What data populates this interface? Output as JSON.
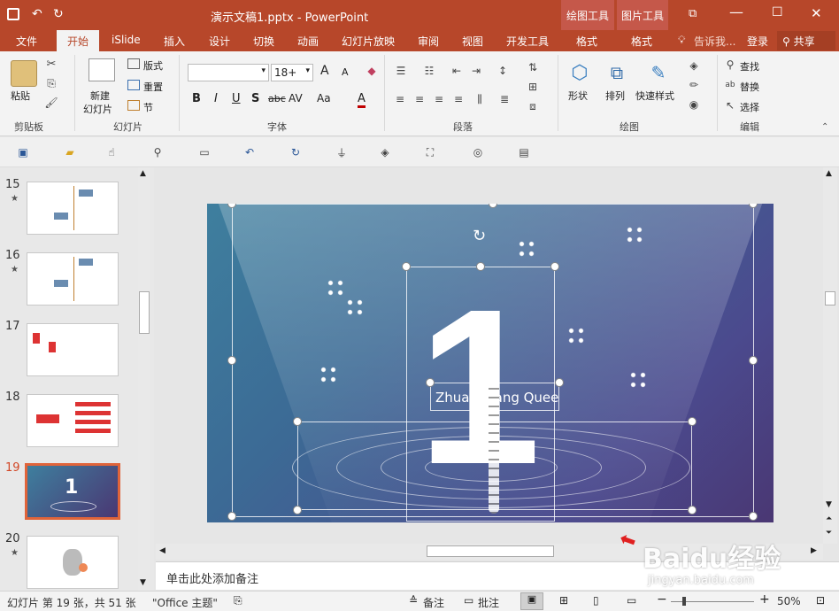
{
  "window": {
    "title": "演示文稿1.pptx - PowerPoint",
    "context_tab_1": "绘图工具",
    "context_tab_2": "图片工具",
    "controls": [
      "⧉",
      "—",
      "☐",
      "✕"
    ]
  },
  "tabs": [
    {
      "label": "文件"
    },
    {
      "label": "开始",
      "active": true
    },
    {
      "label": "iSlide"
    },
    {
      "label": "插入"
    },
    {
      "label": "设计"
    },
    {
      "label": "切换"
    },
    {
      "label": "动画"
    },
    {
      "label": "幻灯片放映"
    },
    {
      "label": "审阅"
    },
    {
      "label": "视图"
    },
    {
      "label": "开发工具"
    },
    {
      "label": "格式"
    },
    {
      "label": "格式"
    }
  ],
  "tab_right": {
    "tell_me": "告诉我...",
    "login": "登录",
    "share": "共享"
  },
  "ribbon": {
    "clipboard": {
      "paste": "粘贴",
      "group": "剪贴板"
    },
    "slides": {
      "new_slide_1": "新建",
      "new_slide_2": "幻灯片",
      "layout": "版式",
      "reset": "重置",
      "section": "节",
      "group": "幻灯片"
    },
    "font": {
      "font_name": "",
      "font_size": "18+",
      "bold": "B",
      "italic": "I",
      "underline": "U",
      "shadow": "S",
      "strike": "abc",
      "spacing": "AV",
      "case": "Aa",
      "color": "A",
      "grow": "A",
      "shrink": "A",
      "group": "字体"
    },
    "paragraph": {
      "group": "段落"
    },
    "drawing": {
      "shape": "形状",
      "arrange": "排列",
      "quick_style": "快速样式",
      "group": "绘图"
    },
    "editing": {
      "find": "查找",
      "replace": "替换",
      "select": "选择",
      "group": "编辑"
    }
  },
  "thumbnails": [
    {
      "num": "15",
      "star": "★"
    },
    {
      "num": "16",
      "star": "★"
    },
    {
      "num": "17",
      "star": ""
    },
    {
      "num": "18",
      "star": ""
    },
    {
      "num": "19",
      "star": ""
    },
    {
      "num": "20",
      "star": "★"
    }
  ],
  "slide": {
    "big_number": "1",
    "caption": "Zhuan Wang Quee"
  },
  "notes": {
    "placeholder": "单击此处添加备注"
  },
  "status": {
    "slide_info": "幻灯片 第 19 张，共 51 张",
    "theme": "\"Office 主题\"",
    "notes_btn": "备注",
    "comments_btn": "批注",
    "zoom": "50%"
  },
  "watermark": {
    "brand": "Baidu经验",
    "url": "jingyan.baidu.com"
  },
  "colors": {
    "accent": "#b7472a",
    "selected_thumb": "#e0643a",
    "slide_start": "#3e7f9e",
    "slide_end": "#4a3773"
  }
}
